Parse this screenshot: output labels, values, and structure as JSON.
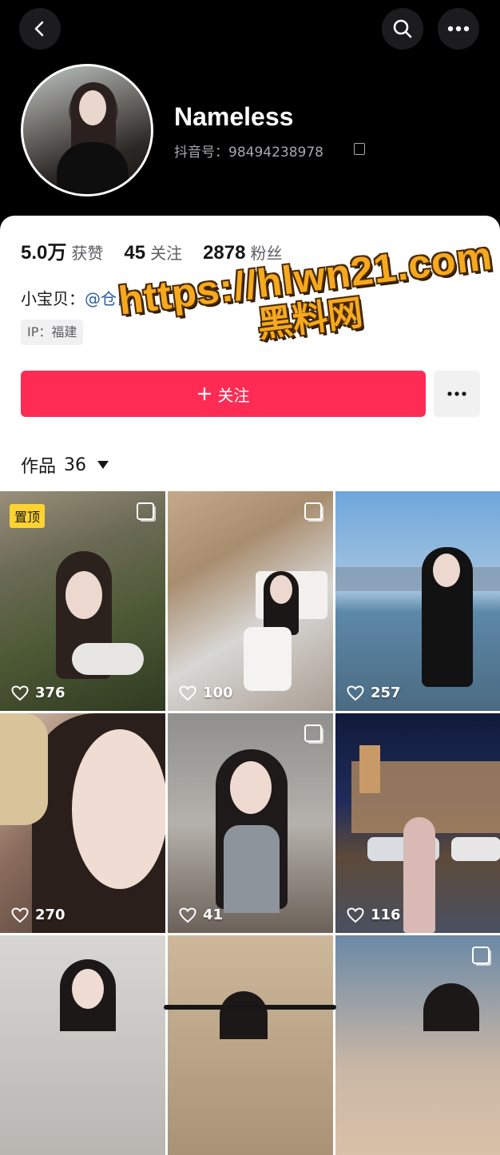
{
  "profile": {
    "name": "Nameless",
    "douyin_id": "抖音号：98494238978",
    "bio_prefix": "小宝贝：",
    "bio_link": "@仓鼠",
    "ip": "IP：福建"
  },
  "stats": [
    {
      "value": "5.0万",
      "label": "获赞"
    },
    {
      "value": "45",
      "label": "关注"
    },
    {
      "value": "2878",
      "label": "粉丝"
    }
  ],
  "actions": {
    "follow_label": "关注"
  },
  "works": {
    "label": "作品",
    "count": "36"
  },
  "watermark": {
    "line1": "https://hlwn21.com",
    "line2": "黑料网"
  },
  "pinned_label": "置顶",
  "videos": [
    {
      "likes": "376"
    },
    {
      "likes": "100"
    },
    {
      "likes": "257"
    },
    {
      "likes": "270"
    },
    {
      "likes": "41"
    },
    {
      "likes": "116"
    }
  ],
  "colors": {
    "follow": "#fe2c55",
    "link": "#2c5d9f",
    "pin": "#fcd330",
    "watermark": "#f6a91e"
  }
}
